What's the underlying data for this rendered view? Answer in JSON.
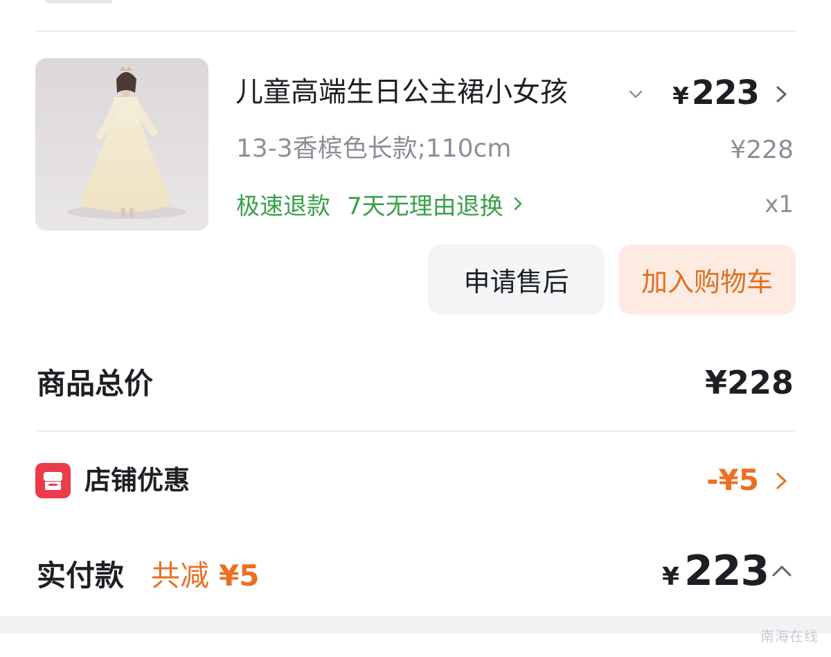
{
  "product": {
    "title": "儿童高端生日公主裙小女孩",
    "image_alt": "white-princess-dress-photo",
    "spec": "13-3香槟色长款;110cm",
    "price_currency": "¥",
    "price_value": "223",
    "original_price": "¥228",
    "quantity": "x1",
    "tags": {
      "fast_refund": "极速退款",
      "seven_day_return": "7天无理由退换"
    }
  },
  "actions": {
    "after_sale": "申请售后",
    "add_to_cart": "加入购物车"
  },
  "summary": {
    "total_label": "商品总价",
    "total_value": "¥228",
    "shop_discount_label": "店铺优惠",
    "shop_discount_value": "-¥5",
    "pay_label": "实付款",
    "saved_label": "共减",
    "saved_value": "¥5",
    "pay_currency": "¥",
    "pay_value": "223"
  },
  "watermark": "南海在线",
  "icons": {
    "expand": "chevron-down-icon",
    "detail": "chevron-right-icon",
    "shop": "shop-icon",
    "collapse": "chevron-up-icon"
  },
  "colors": {
    "accent_orange": "#e97124",
    "service_green": "#3aa04a",
    "shop_red": "#ec3b4b",
    "muted_gray": "#8a8f96"
  }
}
